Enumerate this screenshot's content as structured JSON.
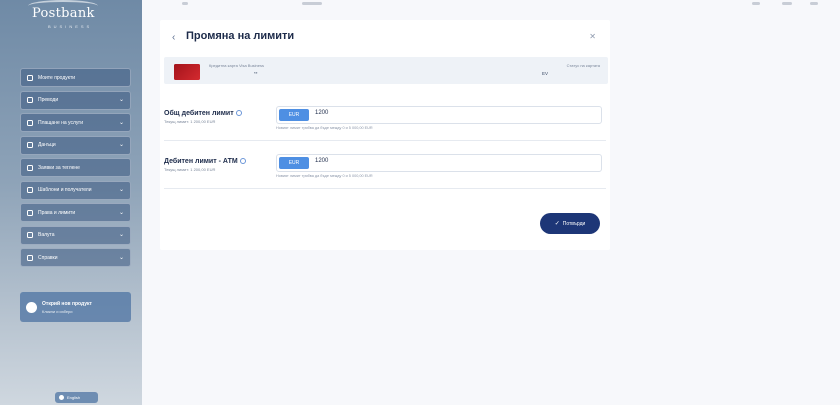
{
  "sidebar": {
    "logo": "Postbank",
    "logo_sub": "BUSINESS",
    "items": [
      {
        "label": "Моите продукти",
        "chevron": false
      },
      {
        "label": "Преводи",
        "chevron": true
      },
      {
        "label": "Плащане на услуги",
        "chevron": true
      },
      {
        "label": "Данъци",
        "chevron": true
      },
      {
        "label": "Заявки за теглене",
        "chevron": false
      },
      {
        "label": "Шаблони и получатели",
        "chevron": true
      },
      {
        "label": "Права и лимити",
        "chevron": true
      },
      {
        "label": "Валута",
        "chevron": true
      },
      {
        "label": "Справки",
        "chevron": true
      }
    ],
    "chevron_glyph": "⌄",
    "promo": {
      "title": "Открий нов продукт",
      "subtitle": "Кликни и избери"
    },
    "language": "English"
  },
  "dialog": {
    "back_glyph": "‹",
    "title": "Промяна на лимити",
    "close_glyph": "✕",
    "card": {
      "name": "Кредитна карта Visa Business",
      "number": "**",
      "status_label": "Статус на картата",
      "status_value": "EV"
    },
    "limits": [
      {
        "label": "Общ дебитен лимит",
        "current": "Текущ лимит: 1 200,00 EUR",
        "currency": "EUR",
        "value": "1200",
        "hint": "Новият лимит трябва да бъде между 0 и 5 000,00 EUR"
      },
      {
        "label": "Дебитен лимит - АТМ",
        "current": "Текущ лимит: 1 200,00 EUR",
        "currency": "EUR",
        "value": "1200",
        "hint": "Новият лимит трябва да бъде между 0 и 5 000,00 EUR"
      }
    ],
    "confirm_label": "Потвърди",
    "confirm_glyph": "✓"
  }
}
